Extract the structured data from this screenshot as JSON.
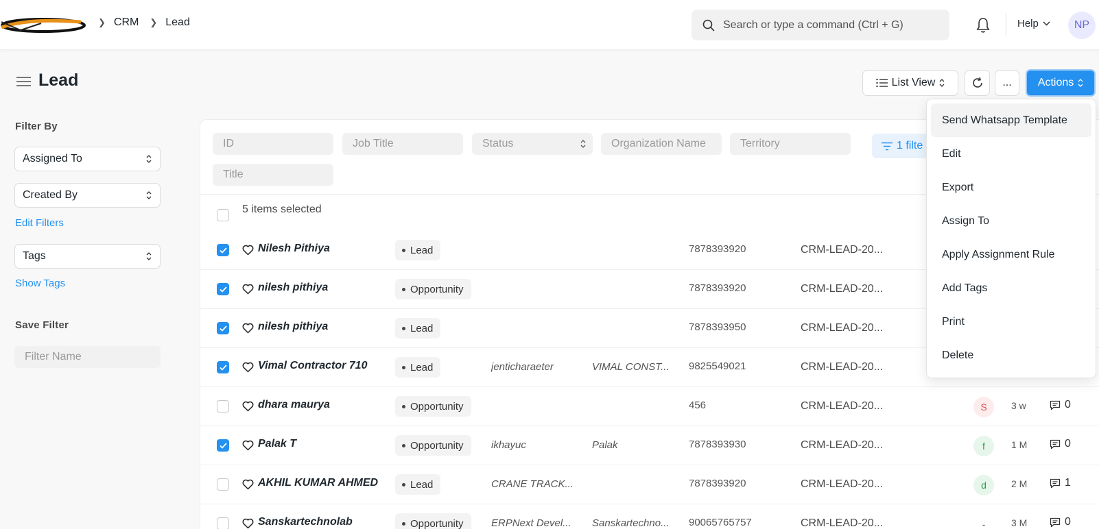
{
  "navbar": {
    "breadcrumbs": [
      "CRM",
      "Lead"
    ],
    "search_placeholder": "Search or type a command (Ctrl + G)",
    "help_label": "Help",
    "avatar_initials": "NP"
  },
  "page": {
    "title": "Lead",
    "list_view_label": "List View",
    "more_label": "...",
    "actions_label": "Actions"
  },
  "sidebar": {
    "filter_by_heading": "Filter By",
    "assigned_to_label": "Assigned To",
    "created_by_label": "Created By",
    "edit_filters_label": "Edit Filters",
    "tags_label": "Tags",
    "show_tags_label": "Show Tags",
    "save_filter_heading": "Save Filter",
    "filter_name_placeholder": "Filter Name"
  },
  "filters": {
    "id_placeholder": "ID",
    "job_title_placeholder": "Job Title",
    "status_placeholder": "Status",
    "organization_placeholder": "Organization Name",
    "territory_placeholder": "Territory",
    "title_placeholder": "Title",
    "filter_button_label": "1 filte"
  },
  "list": {
    "selection_text": "5 items selected",
    "rows": [
      {
        "name": "Nilesh Pithiya",
        "status": "Lead",
        "job_title": "",
        "organization": "",
        "phone": "7878393920",
        "lead_id": "CRM-LEAD-20...",
        "checked": true,
        "assigned": "",
        "time": "",
        "comments": ""
      },
      {
        "name": "nilesh pithiya",
        "status": "Opportunity",
        "job_title": "",
        "organization": "",
        "phone": "7878393920",
        "lead_id": "CRM-LEAD-20...",
        "checked": true,
        "assigned": "",
        "time": "",
        "comments": ""
      },
      {
        "name": "nilesh pithiya",
        "status": "Lead",
        "job_title": "",
        "organization": "",
        "phone": "7878393950",
        "lead_id": "CRM-LEAD-20...",
        "checked": true,
        "assigned": "",
        "time": "",
        "comments": ""
      },
      {
        "name": "Vimal Contractor 710",
        "status": "Lead",
        "job_title": "jenticharaeter",
        "organization": "VIMAL CONST...",
        "phone": "9825549021",
        "lead_id": "CRM-LEAD-20...",
        "checked": true,
        "assigned": "",
        "time": "",
        "comments": ""
      },
      {
        "name": "dhara maurya",
        "status": "Opportunity",
        "job_title": "",
        "organization": "",
        "phone": "456",
        "lead_id": "CRM-LEAD-20...",
        "checked": false,
        "assigned": "S",
        "time": "3 w",
        "comments": "0"
      },
      {
        "name": "Palak T",
        "status": "Opportunity",
        "job_title": "ikhayuc",
        "organization": "Palak",
        "phone": "7878393930",
        "lead_id": "CRM-LEAD-20...",
        "checked": true,
        "assigned": "f",
        "time": "1 M",
        "comments": "0"
      },
      {
        "name": "AKHIL KUMAR AHMED",
        "status": "Lead",
        "job_title": "CRANE TRACK...",
        "organization": "",
        "phone": "7878393920",
        "lead_id": "CRM-LEAD-20...",
        "checked": false,
        "assigned": "d",
        "time": "2 M",
        "comments": "1"
      },
      {
        "name": "Sanskartechnolab",
        "status": "Opportunity",
        "job_title": "ERPNext Devel...",
        "organization": "Sanskartechno...",
        "phone": "90065765757",
        "lead_id": "CRM-LEAD-20...",
        "checked": false,
        "assigned": "-",
        "time": "3 M",
        "comments": "0"
      }
    ]
  },
  "actions_menu": {
    "items": [
      "Send Whatsapp Template",
      "Edit",
      "Export",
      "Assign To",
      "Apply Assignment Rule",
      "Add Tags",
      "Print",
      "Delete"
    ]
  },
  "colors": {
    "primary": "#2490ef",
    "assign_s_bg": "#fdecec",
    "assign_s_fg": "#e04a4a",
    "assign_f_bg": "#e6f6ea",
    "assign_f_fg": "#2f9c53",
    "assign_d_bg": "#e6f6ea",
    "assign_d_fg": "#2f9c53"
  }
}
